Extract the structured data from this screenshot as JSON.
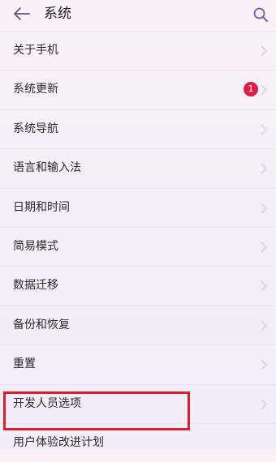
{
  "header": {
    "title": "系统"
  },
  "menu": {
    "items": [
      {
        "label": "关于手机"
      },
      {
        "label": "系统更新",
        "badge": "1"
      },
      {
        "label": "系统导航"
      },
      {
        "label": "语言和输入法"
      },
      {
        "label": "日期和时间"
      },
      {
        "label": "简易模式"
      },
      {
        "label": "数据迁移"
      },
      {
        "label": "备份和恢复"
      },
      {
        "label": "重置"
      },
      {
        "label": "开发人员选项"
      },
      {
        "label": "用户体验改进计划"
      }
    ]
  },
  "colors": {
    "badge": "#dc1e48",
    "highlight_border": "#d5202e",
    "accent_icon": "#6a5fb0"
  }
}
